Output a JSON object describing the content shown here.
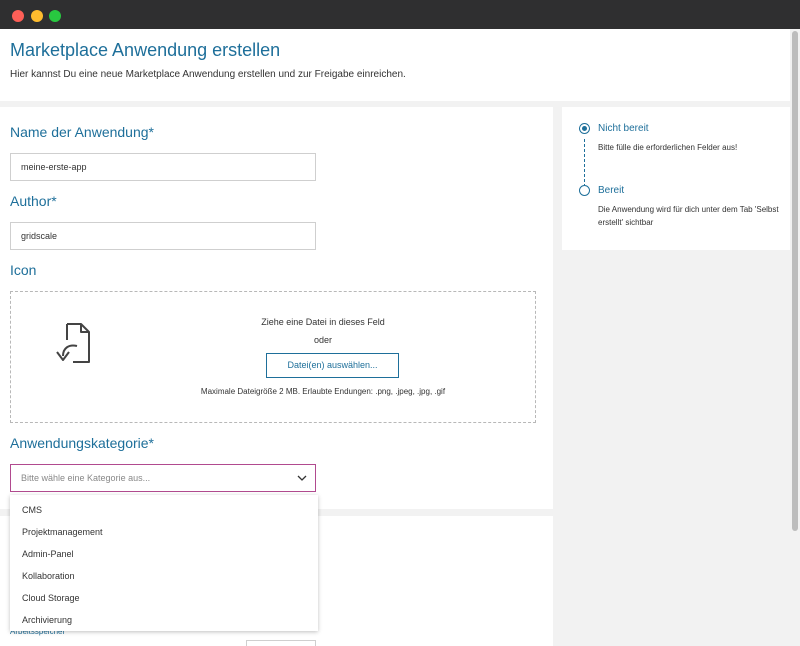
{
  "header": {
    "title": "Marketplace Anwendung erstellen",
    "subtitle": "Hier kannst Du eine neue Marketplace Anwendung erstellen und zur Freigabe einreichen."
  },
  "form": {
    "name_label": "Name der Anwendung*",
    "name_value": "meine-erste-app",
    "author_label": "Author*",
    "author_value": "gridscale",
    "icon_label": "Icon",
    "drop_text": "Ziehe eine Datei in dieses Feld",
    "drop_or": "oder",
    "select_files_label": "Datei(en) auswählen...",
    "file_hint": "Maximale Dateigröße 2 MB. Erlaubte Endungen: .png, .jpeg, .jpg, .gif",
    "category_label": "Anwendungskategorie*",
    "category_placeholder": "Bitte wähle eine Kategorie aus...",
    "category_options": [
      "CMS",
      "Projektmanagement",
      "Admin-Panel",
      "Kollaboration",
      "Cloud Storage",
      "Archivierung"
    ],
    "partial_label": "Arbeitsspeicher*"
  },
  "status": {
    "steps": [
      {
        "title": "Nicht bereit",
        "description": "Bitte fülle die erforderlichen Felder aus!",
        "active": true
      },
      {
        "title": "Bereit",
        "description": "Die Anwendung wird für dich unter dem Tab 'Selbst erstellt' sichtbar",
        "active": false
      }
    ]
  },
  "colors": {
    "accent": "#1e6f9a",
    "focus_border": "#b14a8f",
    "titlebar": "#2f2f30"
  }
}
